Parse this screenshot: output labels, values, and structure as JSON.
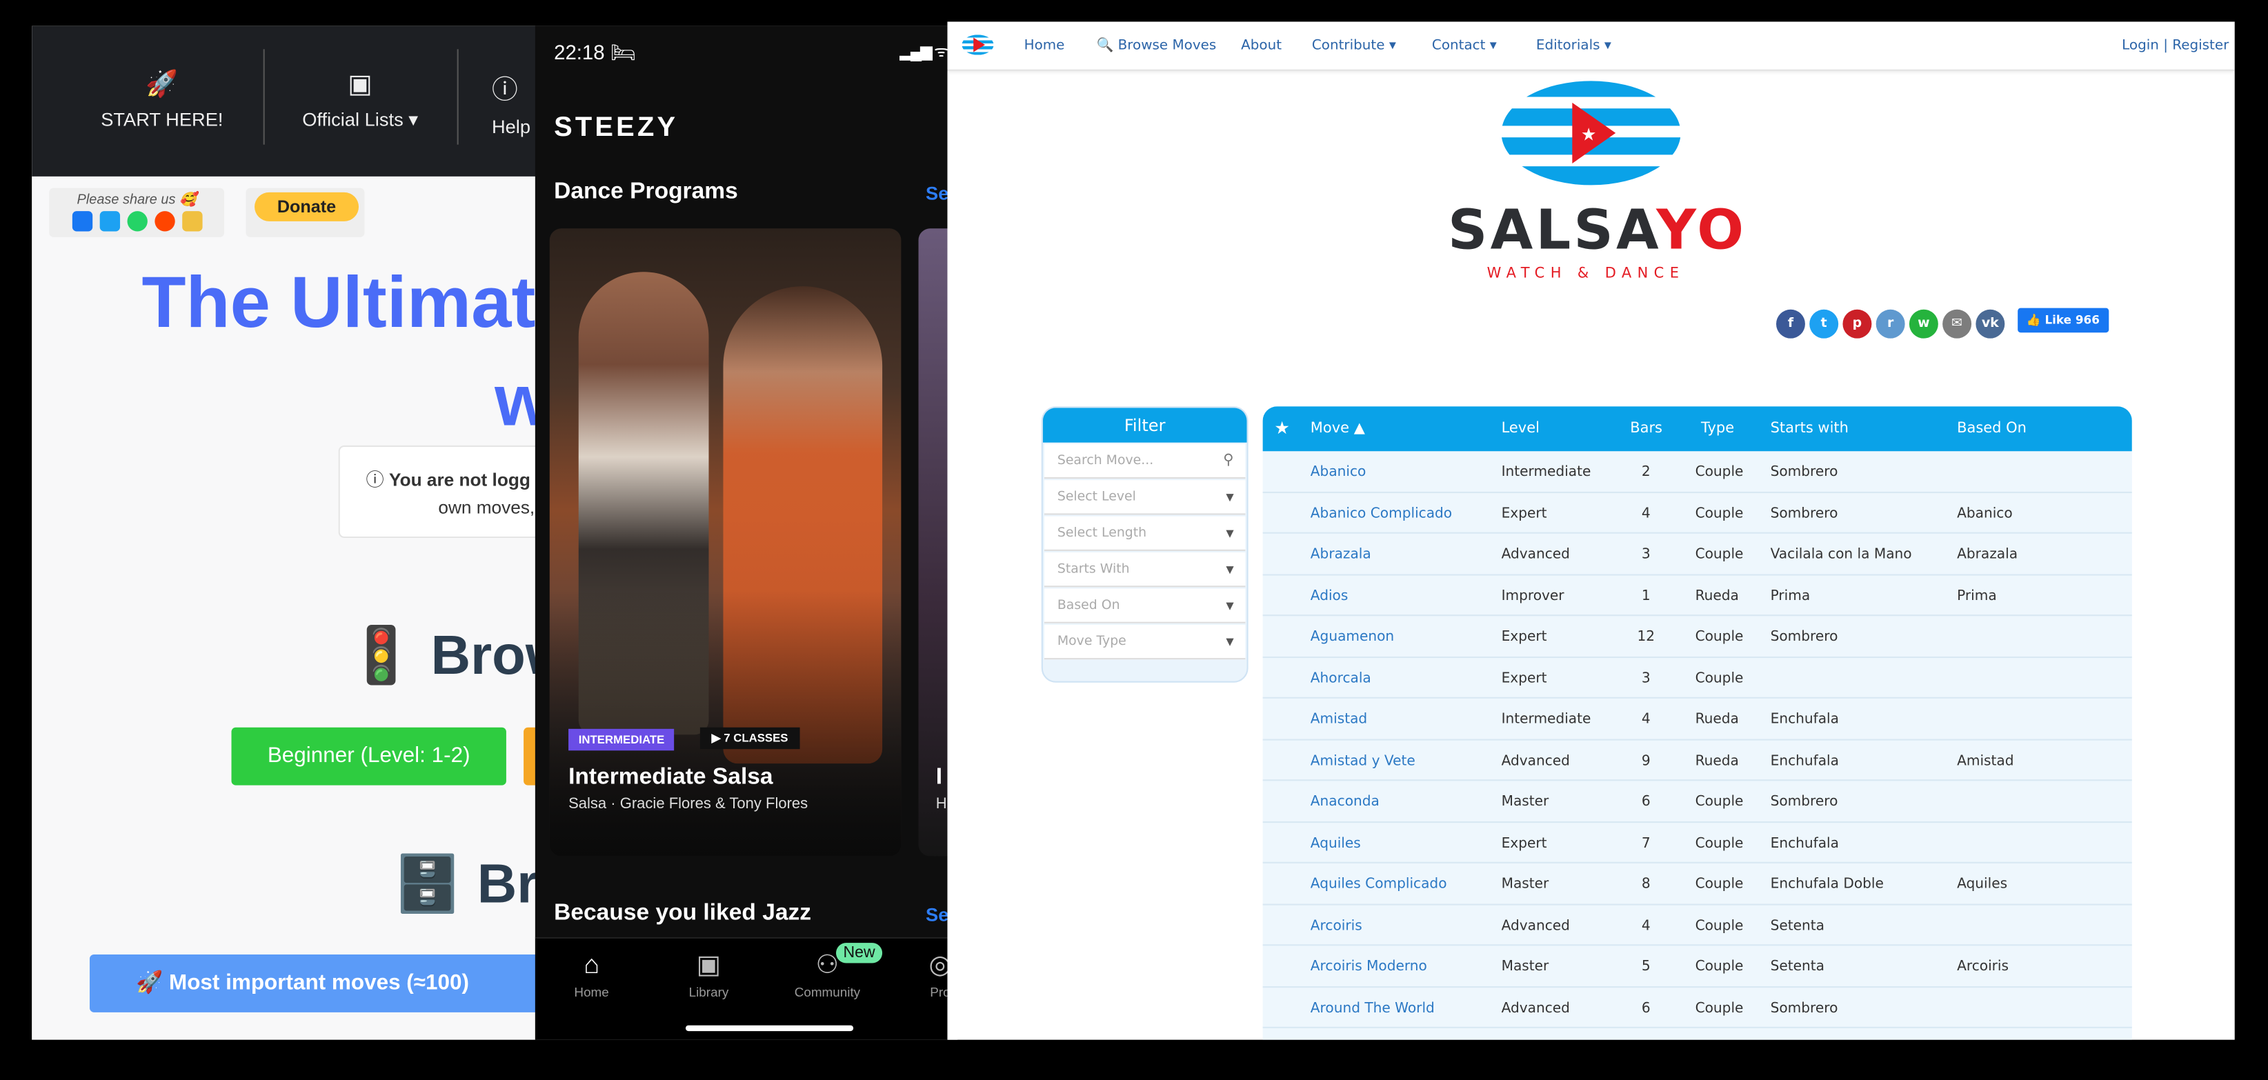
{
  "left_site": {
    "nav": [
      {
        "label": "START HERE!",
        "icon": "rocket-icon"
      },
      {
        "label": "Official Lists ▾",
        "icon": "playlist-icon"
      },
      {
        "label": "Help",
        "icon": "help-icon"
      }
    ],
    "share_label": "Please share us 🥰",
    "donate_label": "Donate",
    "title_line1": "The Ultimat",
    "title_line2": "w",
    "notice_bold": "You are not logg",
    "notice_rest": "own moves,",
    "browse1": "🚦 Brows",
    "beginner_label": "Beginner (Level: 1-2)",
    "browse2": "🗄️ Bro",
    "most_important": "🚀 Most important moves (≈100)"
  },
  "phone": {
    "time": "22:18 🛏",
    "status": "▂▄▆ ᯤ",
    "logo": "STEEZY",
    "section1": "Dance Programs",
    "see": "Se",
    "card": {
      "level": "INTERMEDIATE",
      "classes": "▶  7 CLASSES",
      "title": "Intermediate Salsa",
      "subtitle": "Salsa  ·  Gracie Flores & Tony Flores"
    },
    "card2_peek": {
      "title": "I",
      "subtitle": "H"
    },
    "section2": "Because you liked Jazz",
    "tabs": [
      {
        "label": "Home",
        "icon": "home-icon"
      },
      {
        "label": "Library",
        "icon": "library-icon"
      },
      {
        "label": "Community",
        "icon": "community-icon"
      },
      {
        "label": "Pro",
        "icon": "profile-icon"
      }
    ],
    "new_badge": "New"
  },
  "salsayo": {
    "nav": [
      "Home",
      "🔍 Browse Moves",
      "About",
      "Contribute ▾",
      "Contact ▾",
      "Editorials ▾"
    ],
    "login": "Login | Register",
    "brand_a": "SALSA",
    "brand_b": "YO",
    "tagline": "WATCH & DANCE",
    "like": "👍 Like 966",
    "colors": {
      "accent": "#0aa2e8",
      "brand_red": "#e41b23",
      "link": "#2b78c4"
    },
    "filter": {
      "title": "Filter",
      "search_placeholder": "Search Move...",
      "selects": [
        "Select Level",
        "Select Length",
        "Starts With",
        "Based On",
        "Move Type"
      ]
    },
    "columns": [
      "Move ▲",
      "Level",
      "Bars",
      "Type",
      "Starts with",
      "Based On"
    ],
    "rows": [
      [
        "Abanico",
        "Intermediate",
        "2",
        "Couple",
        "Sombrero",
        ""
      ],
      [
        "Abanico Complicado",
        "Expert",
        "4",
        "Couple",
        "Sombrero",
        "Abanico"
      ],
      [
        "Abrazala",
        "Advanced",
        "3",
        "Couple",
        "Vacilala con la Mano",
        "Abrazala"
      ],
      [
        "Adios",
        "Improver",
        "1",
        "Rueda",
        "Prima",
        "Prima"
      ],
      [
        "Aguamenon",
        "Expert",
        "12",
        "Couple",
        "Sombrero",
        ""
      ],
      [
        "Ahorcala",
        "Expert",
        "3",
        "Couple",
        "",
        ""
      ],
      [
        "Amistad",
        "Intermediate",
        "4",
        "Rueda",
        "Enchufala",
        ""
      ],
      [
        "Amistad y Vete",
        "Advanced",
        "9",
        "Rueda",
        "Enchufala",
        "Amistad"
      ],
      [
        "Anaconda",
        "Master",
        "6",
        "Couple",
        "Sombrero",
        ""
      ],
      [
        "Aquiles",
        "Expert",
        "7",
        "Couple",
        "Enchufala",
        ""
      ],
      [
        "Aquiles Complicado",
        "Master",
        "8",
        "Couple",
        "Enchufala Doble",
        "Aquiles"
      ],
      [
        "Arcoiris",
        "Advanced",
        "4",
        "Couple",
        "Setenta",
        ""
      ],
      [
        "Arcoiris Moderno",
        "Master",
        "5",
        "Couple",
        "Setenta",
        "Arcoiris"
      ],
      [
        "Around The World",
        "Advanced",
        "6",
        "Couple",
        "Sombrero",
        ""
      ]
    ]
  }
}
